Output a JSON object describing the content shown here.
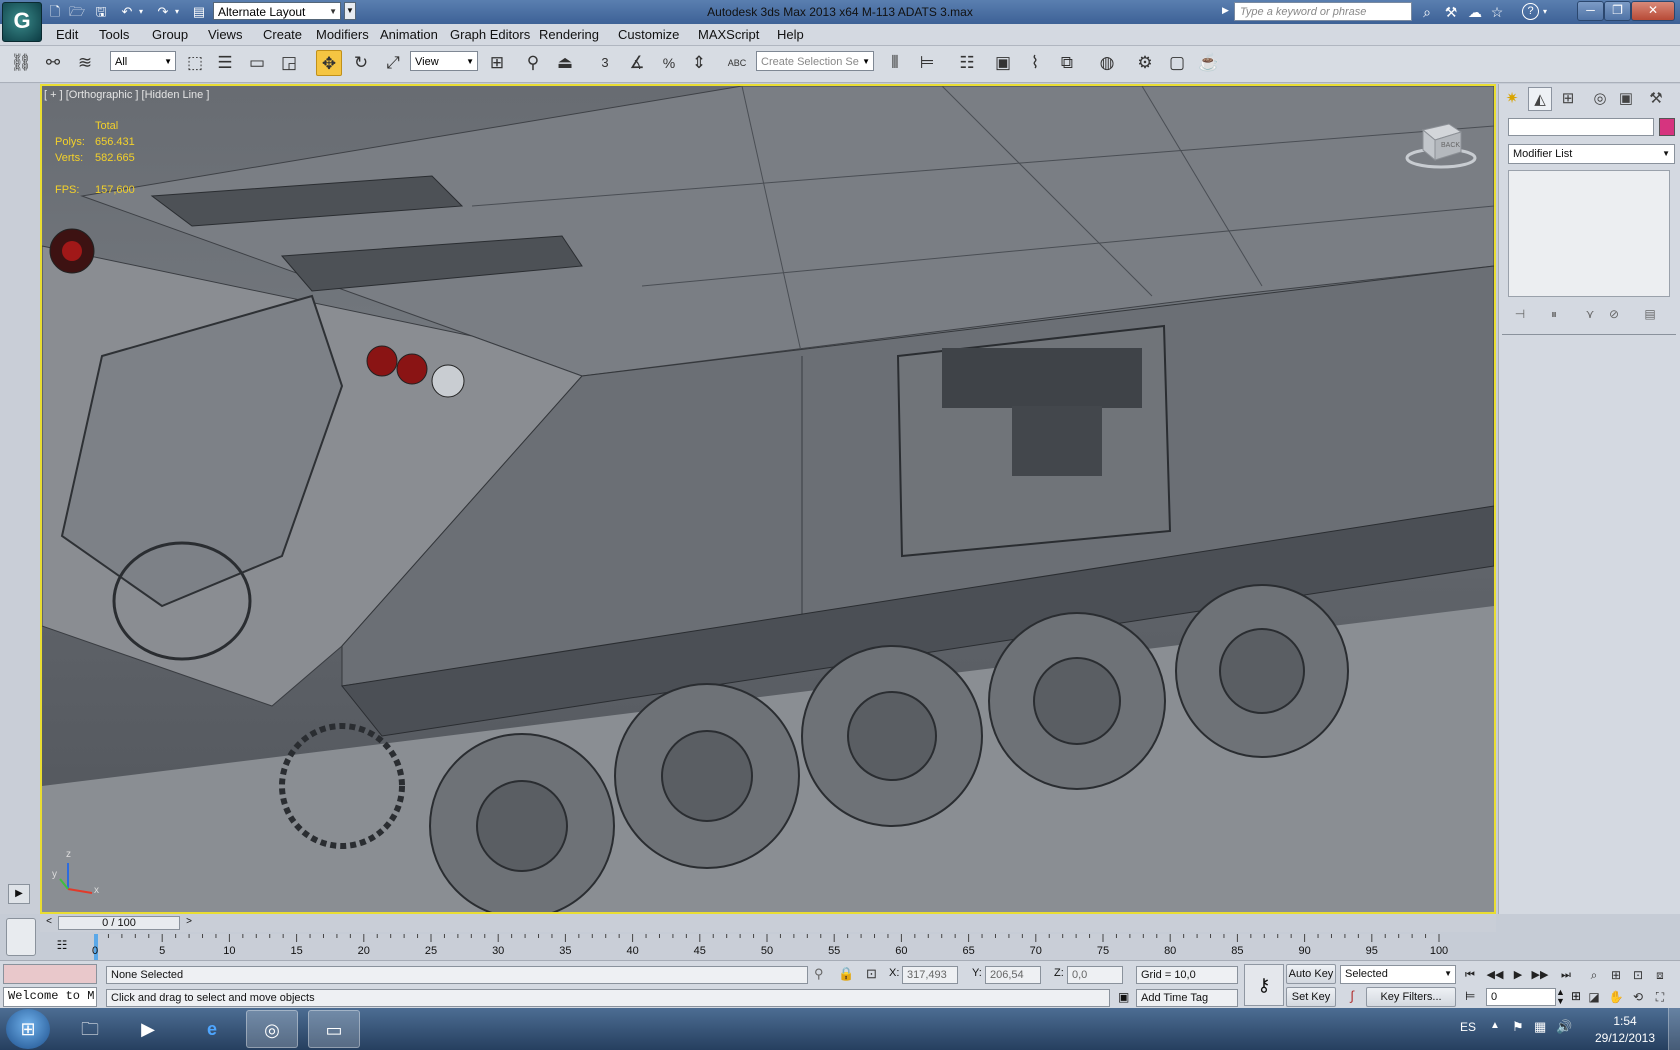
{
  "app": {
    "title": "Autodesk 3ds Max  2013 x64      M-113 ADATS 3.max",
    "logo_glyph": "G",
    "workspace": "Alternate Layout",
    "search_placeholder": "Type a keyword or phrase",
    "help_glyph": "?"
  },
  "window_controls": {
    "minimize": "─",
    "maximize": "❐",
    "close": "✕"
  },
  "menu": [
    "Edit",
    "Tools",
    "Group",
    "Views",
    "Create",
    "Modifiers",
    "Animation",
    "Graph Editors",
    "Rendering",
    "Customize",
    "MAXScript",
    "Help"
  ],
  "toolbar": {
    "selection_filter": "All",
    "reference_coordinate": "View",
    "named_selection_placeholder": "Create Selection Se",
    "snap_label": "3",
    "percent_snap_label": "%",
    "spelling_label": "ABC"
  },
  "viewport": {
    "label": "[ + ] [Orthographic ] [Hidden Line ]",
    "stats_header": "Total",
    "polys_label": "Polys:",
    "polys_value": "656.431",
    "verts_label": "Verts:",
    "verts_value": "582.665",
    "fps_label": "FPS:",
    "fps_value": "157,600",
    "axis_x": "x",
    "axis_y": "y",
    "axis_z": "z",
    "viewcube_label": "BACK"
  },
  "command_panel": {
    "modifier_list": "Modifier List",
    "object_color": "#d6347f"
  },
  "timeline": {
    "slider": "0 / 100",
    "prev": "<",
    "next": ">",
    "ticks": [
      "0",
      "5",
      "10",
      "15",
      "20",
      "25",
      "30",
      "35",
      "40",
      "45",
      "50",
      "55",
      "60",
      "65",
      "70",
      "75",
      "80",
      "85",
      "90",
      "95",
      "100"
    ]
  },
  "status": {
    "maxscript_listener": "Welcome to M",
    "selection": "None Selected",
    "prompt": "Click and drag to select and move objects",
    "x_label": "X:",
    "x_value": "317,493",
    "y_label": "Y:",
    "y_value": "206,54",
    "z_label": "Z:",
    "z_value": "0,0",
    "grid": "Grid = 10,0",
    "add_time_tag": "Add Time Tag",
    "auto_key": "Auto Key",
    "set_key": "Set Key",
    "key_mode": "Selected",
    "key_filters": "Key Filters...",
    "current_frame": "0"
  },
  "taskbar": {
    "language": "ES",
    "time": "1:54",
    "date": "29/12/2013"
  }
}
